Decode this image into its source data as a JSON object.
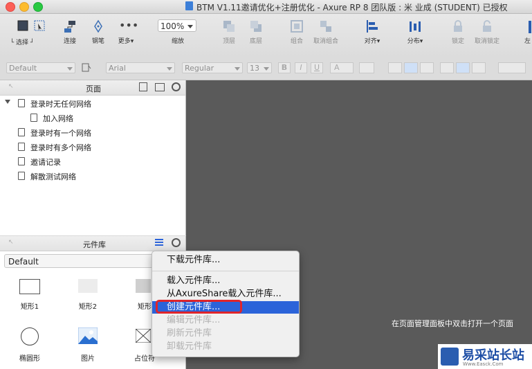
{
  "window": {
    "title": "BTM V1.11邀请优化+注册优化 - Axure RP 8 团队版 : 米 业成 (STUDENT) 已授权"
  },
  "toolbar": {
    "select": "选择",
    "connect": "连接",
    "pen": "钢笔",
    "more": "更多▾",
    "zoom_value": "100%",
    "zoom": "缩放",
    "top": "顶层",
    "bottom": "底层",
    "group": "组合",
    "ungroup": "取消组合",
    "align": "对齐▾",
    "distribute": "分布▾",
    "lock": "锁定",
    "unlock": "取消锁定",
    "left_cut": "左"
  },
  "format": {
    "style": "Default",
    "font": "Arial",
    "weight": "Regular",
    "size": "13",
    "bold": "B",
    "italic": "I",
    "underline": "U",
    "textcolor": "A"
  },
  "pages": {
    "title": "页面",
    "items": [
      {
        "label": "登录时无任何网络"
      },
      {
        "label": "加入网络"
      },
      {
        "label": "登录时有一个网络"
      },
      {
        "label": "登录时有多个网络"
      },
      {
        "label": "邀请记录"
      },
      {
        "label": "解散测试网络"
      }
    ]
  },
  "library": {
    "title": "元件库",
    "selected": "Default",
    "widgets": [
      "矩形1",
      "矩形2",
      "矩形",
      "椭圆形",
      "图片",
      "占位符"
    ]
  },
  "canvas": {
    "hint": "在页面管理面板中双击打开一个页面"
  },
  "menu": {
    "items": [
      "下载元件库...",
      "载入元件库...",
      "从AxureShare载入元件库...",
      "创建元件库...",
      "编辑元件库...",
      "刷新元件库",
      "卸载元件库"
    ]
  },
  "watermark": {
    "text": "易采站长站",
    "sub": "Www.Easck.Com"
  },
  "colors": {
    "accent": "#2b63d9",
    "canvas": "#5a5a5a",
    "highlight": "#e0252a"
  }
}
